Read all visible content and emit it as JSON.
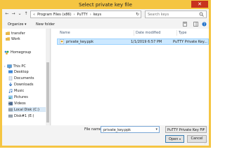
{
  "window": {
    "title": "Select private key file",
    "close_glyph": "✕"
  },
  "nav_buttons": {
    "back_glyph": "←",
    "forward_glyph": "→",
    "recent_glyph": "⌄",
    "up_glyph": "↑"
  },
  "address": {
    "chevron": "«",
    "segments": [
      "Program Files (x86)",
      "PuTTY",
      "keys"
    ],
    "separator": "›",
    "refresh_glyph": "↻"
  },
  "search": {
    "placeholder": "Search keys"
  },
  "toolbar": {
    "organize_label": "Organize ▾",
    "new_folder_label": "New folder"
  },
  "nav_pane": {
    "items": [
      {
        "label": "transfer",
        "icon": "folder-icon"
      },
      {
        "label": "Work",
        "icon": "folder-icon"
      },
      {
        "label": "Homegroup",
        "icon": "homegroup-icon"
      },
      {
        "label": "This PC",
        "icon": "computer-icon"
      },
      {
        "label": "Desktop",
        "icon": "desktop-icon"
      },
      {
        "label": "Documents",
        "icon": "documents-icon"
      },
      {
        "label": "Downloads",
        "icon": "downloads-icon"
      },
      {
        "label": "Music",
        "icon": "music-icon"
      },
      {
        "label": "Pictures",
        "icon": "pictures-icon"
      },
      {
        "label": "Videos",
        "icon": "videos-icon"
      },
      {
        "label": "Local Disk (C:)",
        "icon": "drive-icon"
      },
      {
        "label": "Disk#1 (E:)",
        "icon": "drive-icon"
      }
    ]
  },
  "file_list": {
    "columns": [
      "Name",
      "Date modified",
      "Type"
    ],
    "rows": [
      {
        "name": "private_key.ppk",
        "date": "1/1/2019 6:57 PM",
        "type": "PuTTY Private Key..."
      }
    ]
  },
  "footer": {
    "filename_label": "File name:",
    "filename_value": "private_key.ppk",
    "filetype_value": "PuTTY Private Key Files (*.ppk)",
    "open_label": "Open",
    "cancel_label": "Cancel"
  },
  "colors": {
    "window_frame": "#f5c542",
    "close_button": "#c8321e",
    "selection": "#cce8ff"
  }
}
